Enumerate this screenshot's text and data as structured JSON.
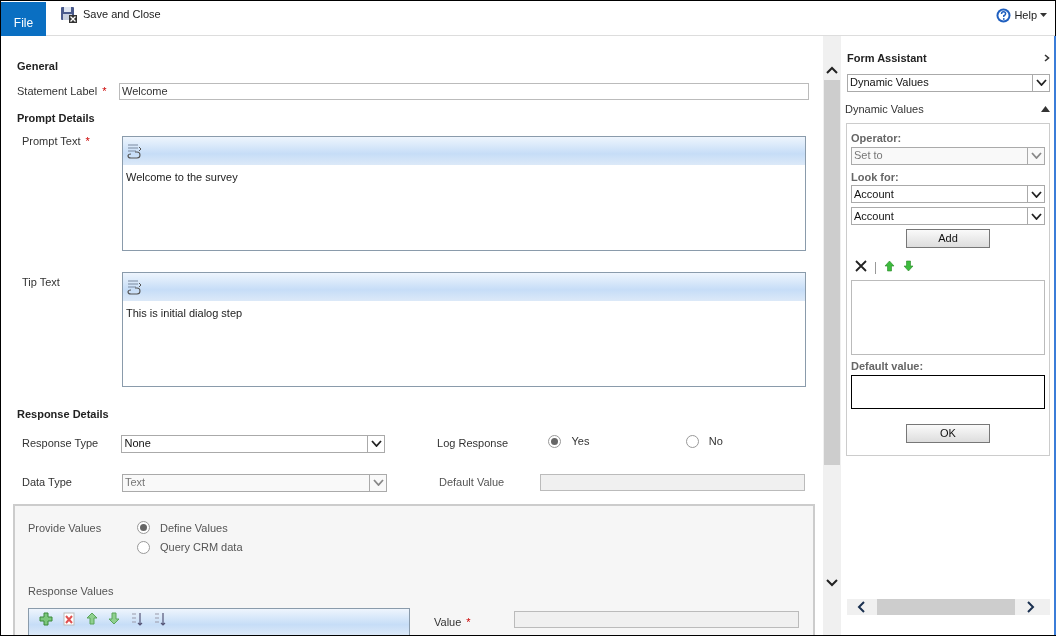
{
  "toolbar": {
    "file_tab": "File",
    "save_close": "Save and Close",
    "help": "Help"
  },
  "form": {
    "general": {
      "heading": "General",
      "statement_label": {
        "label": "Statement Label",
        "required_mark": "*",
        "value": "Welcome"
      }
    },
    "prompt_details": {
      "heading": "Prompt Details",
      "editors": [
        {
          "label": "Prompt Text",
          "required_mark": "*",
          "value": "Welcome to the survey"
        },
        {
          "label": "Tip Text",
          "value": "This is initial dialog step"
        }
      ]
    },
    "response_details": {
      "heading": "Response Details",
      "response_type": {
        "label": "Response Type",
        "value": "None",
        "disabled": false
      },
      "data_type": {
        "label": "Data Type",
        "value": "Text",
        "disabled": true
      },
      "log_response": {
        "label": "Log Response",
        "options": [
          {
            "label": "Yes",
            "selected": true
          },
          {
            "label": "No",
            "selected": false
          }
        ]
      },
      "default_value": {
        "label": "Default Value",
        "disabled": true
      }
    },
    "values_panel": {
      "provide_values": {
        "label": "Provide Values",
        "options": [
          {
            "label": "Define Values",
            "selected": true
          },
          {
            "label": "Query CRM data",
            "selected": false
          }
        ]
      },
      "response_values_label": "Response Values",
      "value_field": {
        "label": "Value",
        "required_mark": "*"
      }
    }
  },
  "form_assistant": {
    "title": "Form Assistant",
    "mode": "Dynamic Values",
    "section": {
      "title": "Dynamic Values",
      "expanded": true,
      "operator": {
        "label": "Operator:",
        "value": "Set to",
        "disabled": true
      },
      "look_for": {
        "label": "Look for:",
        "values": [
          "Account",
          "Account"
        ]
      },
      "add_button": "Add",
      "default_value_label": "Default value:",
      "ok_button": "OK"
    }
  }
}
